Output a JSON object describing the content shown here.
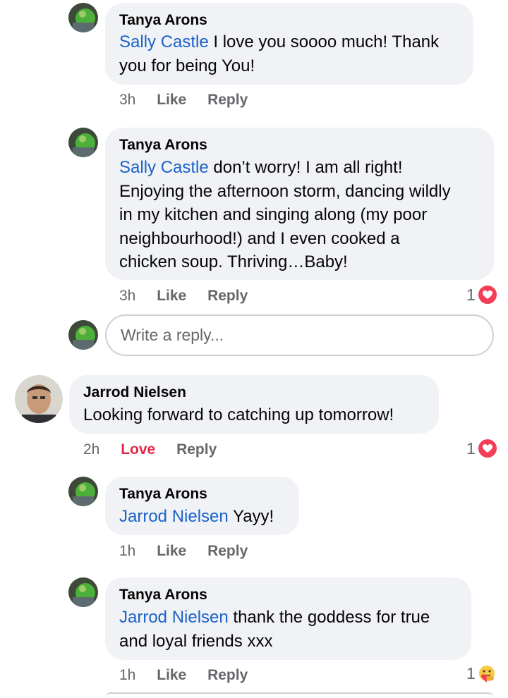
{
  "comments": [
    {
      "author": "Tanya Arons",
      "mention": "Sally Castle",
      "lines": [
        "I love you soooo much! Thank",
        "you for being You!"
      ],
      "time": "3h",
      "like": "Like",
      "reply": "Reply"
    },
    {
      "author": "Tanya Arons",
      "mention": "Sally Castle",
      "lines": [
        "don’t worry! I am all right!",
        "Enjoying the afternoon storm, dancing wildly",
        "in my kitchen and singing along (my poor",
        "neighbourhood!) and I even cooked a",
        "chicken soup.  Thriving…Baby!"
      ],
      "time": "3h",
      "like": "Like",
      "reply": "Reply",
      "reaction_count": "1"
    },
    {
      "author": "Jarrod Nielsen",
      "lines": [
        "Looking forward to catching up tomorrow!"
      ],
      "time": "2h",
      "like": "Love",
      "reply": "Reply",
      "reaction_count": "1"
    },
    {
      "author": "Tanya Arons",
      "mention": "Jarrod Nielsen",
      "lines": [
        "Yayy!"
      ],
      "time": "1h",
      "like": "Like",
      "reply": "Reply"
    },
    {
      "author": "Tanya Arons",
      "mention": "Jarrod Nielsen",
      "lines": [
        "thank the goddess for true",
        "and loyal friends xxx"
      ],
      "time": "1h",
      "like": "Like",
      "reply": "Reply",
      "reaction_count": "1"
    }
  ],
  "reply_box": {
    "placeholder": "Write a reply..."
  },
  "colors": {
    "mention": "#1a62c9",
    "love": "#e2294a",
    "bubble": "#f0f2f5",
    "heart": "#f33e58"
  },
  "icons": {
    "reaction_love": "heart-icon",
    "reaction_care": "care-emoji-icon"
  }
}
